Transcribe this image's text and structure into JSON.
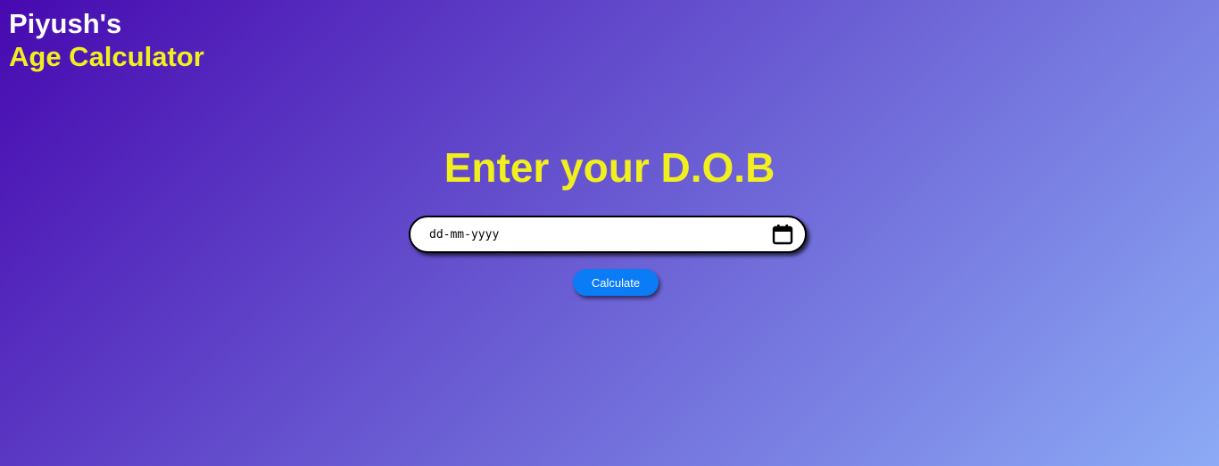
{
  "brand": {
    "owner": "Piyush's",
    "app_name": "Age Calculator"
  },
  "main": {
    "heading": "Enter your D.O.B",
    "dob_input": {
      "placeholder": "dd-mm-yyyy",
      "value": "",
      "icon": "calendar-icon"
    },
    "calculate_label": "Calculate"
  },
  "colors": {
    "accent_yellow": "#f2ef1f",
    "button_blue": "#0a7cf5",
    "gradient_start": "#4709b0",
    "gradient_end": "#8cabf5"
  }
}
